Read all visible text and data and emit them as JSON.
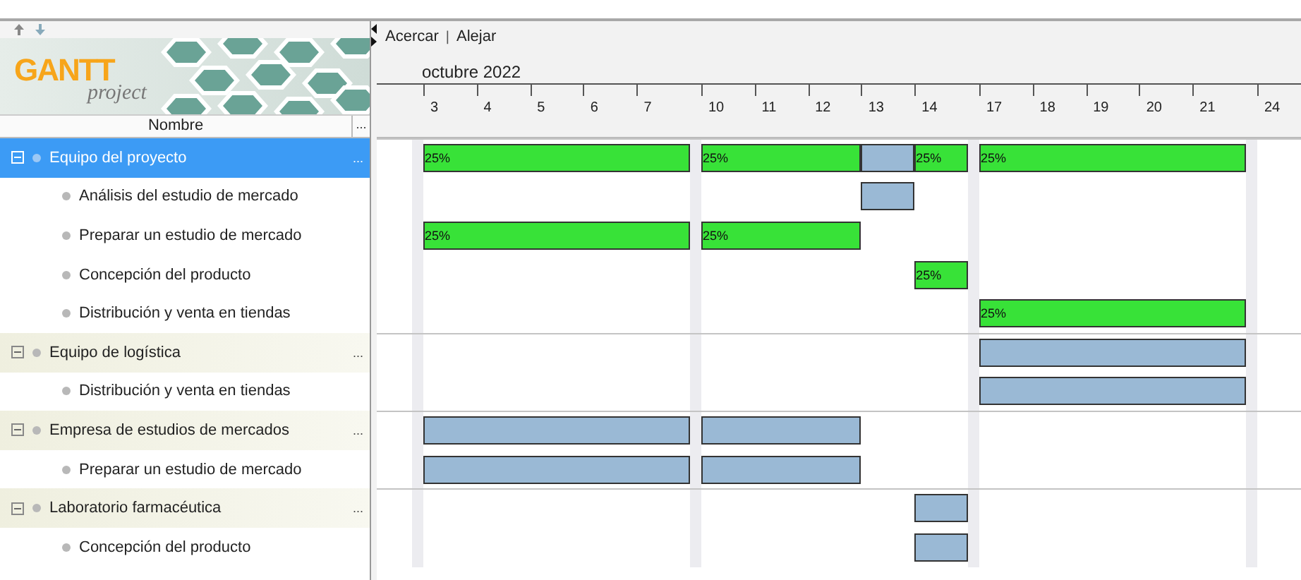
{
  "toolbar": {
    "zoom_in": "Acercar",
    "separator": "|",
    "zoom_out": "Alejar"
  },
  "logo": {
    "name": "GANTT",
    "tagline": "project"
  },
  "tree": {
    "column": "Nombre",
    "column_menu": "..."
  },
  "month": "octubre 2022",
  "days": [
    {
      "label": "3",
      "weekend_before": true
    },
    {
      "label": "4",
      "weekend_before": false
    },
    {
      "label": "5",
      "weekend_before": false
    },
    {
      "label": "6",
      "weekend_before": false
    },
    {
      "label": "7",
      "weekend_before": false
    },
    {
      "label": "10",
      "weekend_before": true
    },
    {
      "label": "11",
      "weekend_before": false
    },
    {
      "label": "12",
      "weekend_before": false
    },
    {
      "label": "13",
      "weekend_before": false
    },
    {
      "label": "14",
      "weekend_before": false
    },
    {
      "label": "17",
      "weekend_before": true
    },
    {
      "label": "18",
      "weekend_before": false
    },
    {
      "label": "19",
      "weekend_before": false
    },
    {
      "label": "20",
      "weekend_before": false
    },
    {
      "label": "21",
      "weekend_before": false
    },
    {
      "label": "24",
      "weekend_before": true
    }
  ],
  "rows": [
    {
      "name": "Equipo del proyecto",
      "kind": "group",
      "expanded": true,
      "selected": true,
      "menu": "...",
      "bars": [
        {
          "kind": "progress",
          "label": "25%"
        },
        {
          "kind": "progress",
          "label": "25%"
        },
        {
          "kind": "plain"
        },
        {
          "kind": "progress",
          "label": "25%"
        },
        {
          "kind": "progress",
          "label": "25%"
        }
      ]
    },
    {
      "name": "Análisis del estudio de mercado",
      "kind": "task",
      "selected": false,
      "bars": [
        {
          "kind": "plain"
        }
      ]
    },
    {
      "name": "Preparar un estudio de mercado",
      "kind": "task",
      "selected": false,
      "bars": [
        {
          "kind": "progress",
          "label": "25%"
        },
        {
          "kind": "progress",
          "label": "25%"
        }
      ]
    },
    {
      "name": "Concepción del producto",
      "kind": "task",
      "selected": false,
      "bars": [
        {
          "kind": "progress",
          "label": "25%"
        }
      ]
    },
    {
      "name": "Distribución y venta en tiendas",
      "kind": "task",
      "selected": false,
      "bars": [
        {
          "kind": "progress",
          "label": "25%"
        }
      ]
    },
    {
      "name": "Equipo de logística",
      "kind": "group",
      "expanded": true,
      "selected": false,
      "menu": "...",
      "bars": [
        {
          "kind": "plain"
        }
      ]
    },
    {
      "name": "Distribución y venta en tiendas",
      "kind": "task",
      "selected": false,
      "bars": [
        {
          "kind": "plain"
        }
      ]
    },
    {
      "name": "Empresa de estudios de mercados",
      "kind": "group",
      "expanded": true,
      "selected": false,
      "menu": "...",
      "bars": [
        {
          "kind": "plain"
        },
        {
          "kind": "plain"
        }
      ]
    },
    {
      "name": "Preparar un estudio de mercado",
      "kind": "task",
      "selected": false,
      "bars": [
        {
          "kind": "plain"
        },
        {
          "kind": "plain"
        }
      ]
    },
    {
      "name": "Laboratorio farmacéutica",
      "kind": "group",
      "expanded": true,
      "selected": false,
      "menu": "...",
      "bars": [
        {
          "kind": "plain"
        }
      ]
    },
    {
      "name": "Concepción del producto",
      "kind": "task",
      "selected": false,
      "bars": [
        {
          "kind": "plain"
        }
      ]
    }
  ]
}
